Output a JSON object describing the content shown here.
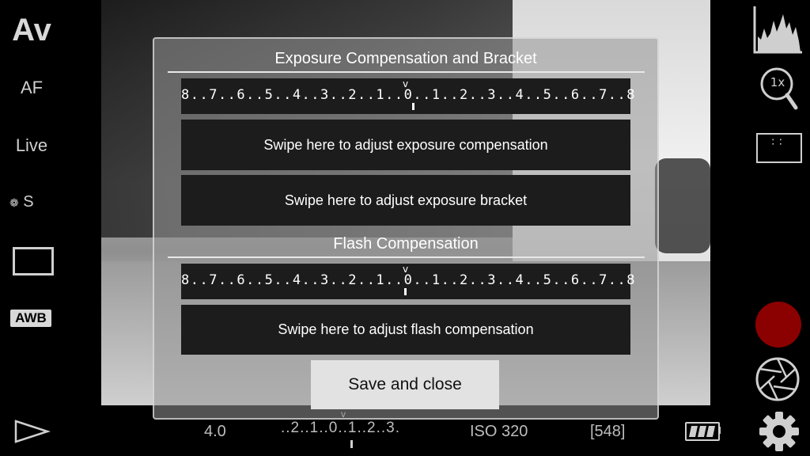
{
  "left_rail": {
    "mode": "Av",
    "focus": "AF",
    "live": "Live",
    "drive": "S",
    "white_balance": "AWB"
  },
  "right_rail": {
    "zoom": "1x"
  },
  "bottom_bar": {
    "aperture": "4.0",
    "ev_scale": "..2..1..0..1..2..3.",
    "iso": "ISO 320",
    "shots_remaining": "[548]"
  },
  "dialog": {
    "exposure_title": "Exposure Compensation and Bracket",
    "exposure_scale": "8..7..6..5..4..3..2..1..0..1..2..3..4..5..6..7..8",
    "swipe_exposure": "Swipe here to adjust exposure compensation",
    "swipe_bracket": "Swipe here to adjust exposure bracket",
    "flash_title": "Flash Compensation",
    "flash_scale": "8..7..6..5..4..3..2..1..0..1..2..3..4..5..6..7..8",
    "swipe_flash": "Swipe here to adjust flash compensation",
    "save_label": "Save and close"
  },
  "colors": {
    "record": "#8b0000",
    "panel": "#1c1c1c"
  }
}
